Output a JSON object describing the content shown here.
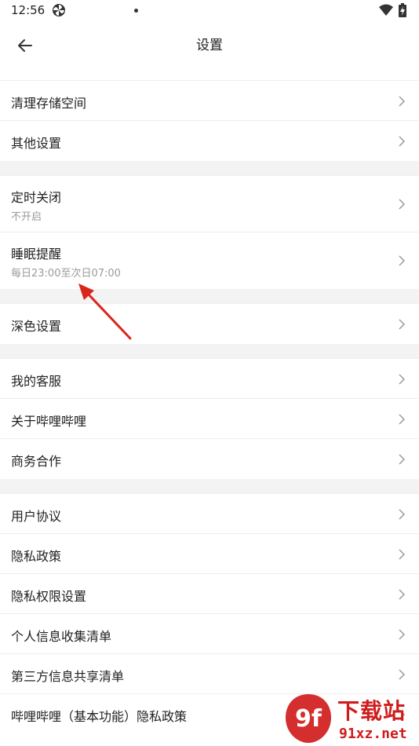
{
  "status_bar": {
    "time": "12:56",
    "app_icon": "pinwheel-icon",
    "wifi_icon": "wifi-icon",
    "battery_icon": "battery-charging-icon"
  },
  "header": {
    "back_icon": "arrow-left-icon",
    "title": "设置"
  },
  "groups": [
    {
      "items": [
        {
          "label": "清理存储空间"
        },
        {
          "label": "其他设置"
        }
      ]
    },
    {
      "items": [
        {
          "label": "定时关闭",
          "sub": "不开启"
        },
        {
          "label": "睡眠提醒",
          "sub": "每日23:00至次日07:00"
        }
      ]
    },
    {
      "items": [
        {
          "label": "深色设置"
        }
      ]
    },
    {
      "items": [
        {
          "label": "我的客服"
        },
        {
          "label": "关于哔哩哔哩"
        },
        {
          "label": "商务合作"
        }
      ]
    },
    {
      "items": [
        {
          "label": "用户协议"
        },
        {
          "label": "隐私政策"
        },
        {
          "label": "隐私权限设置"
        },
        {
          "label": "个人信息收集清单"
        },
        {
          "label": "第三方信息共享清单"
        },
        {
          "label": "哔哩哔哩（基本功能）隐私政策"
        }
      ]
    }
  ],
  "watermark": {
    "logo_text": "9f",
    "cn_text": "下载站",
    "url_text": "91xz.net"
  },
  "colors": {
    "annotation_arrow": "#d9261c",
    "watermark": "#d01c1c",
    "gap": "#f3f3f3"
  }
}
